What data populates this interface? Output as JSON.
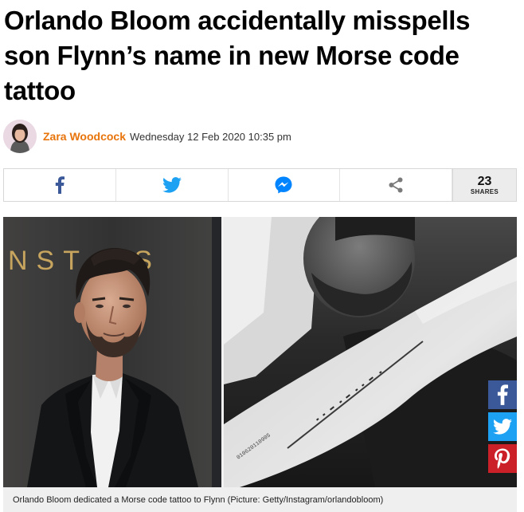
{
  "article": {
    "headline_line1": "Orlando Bloom accidentally misspells",
    "headline_line2": "son Flynn’s name in new Morse code",
    "headline_line3": "tattoo",
    "author": "Zara Woodcock",
    "date": "Wednesday 12 Feb 2020 10:35 pm"
  },
  "share_bar": {
    "buttons": [
      {
        "icon": "facebook-icon",
        "color": "#3b5998"
      },
      {
        "icon": "twitter-icon",
        "color": "#1da1f2"
      },
      {
        "icon": "messenger-icon",
        "color": "#0084ff"
      },
      {
        "icon": "share-icon",
        "color": "#777777"
      }
    ],
    "count": "23",
    "count_label": "SHARES"
  },
  "hero": {
    "left_backdrop_text": "NST OS",
    "tattoo_text": "01062011090S",
    "caption": "Orlando Bloom dedicated a Morse code tattoo to Flynn (Picture: Getty/Instagram/orlandobloom)"
  },
  "floating_share": {
    "buttons": [
      {
        "icon": "facebook-icon",
        "color": "#3b5998"
      },
      {
        "icon": "twitter-icon",
        "color": "#1da1f2"
      },
      {
        "icon": "pinterest-icon",
        "color": "#cb2027"
      }
    ]
  }
}
